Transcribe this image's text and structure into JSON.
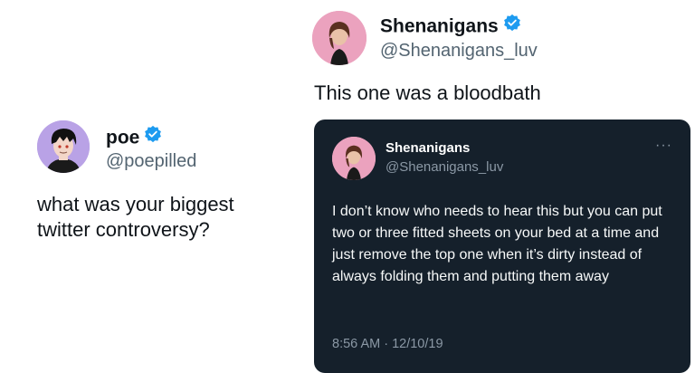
{
  "left_tweet": {
    "display_name": "poe",
    "handle": "@poepilled",
    "text": "what was your biggest twitter controversy?"
  },
  "right_tweet": {
    "display_name": "Shenanigans",
    "handle": "@Shenanigans_luv",
    "text": "This one was a bloodbath"
  },
  "quoted_tweet": {
    "display_name": "Shenanigans",
    "handle": "@Shenanigans_luv",
    "menu": "···",
    "text": "I don’t know who needs to hear this but you can put two or three fitted sheets on your bed at a time and just remove the top one when it’s dirty instead of always folding them and putting them away",
    "timestamp": "8:56 AM · 12/10/19"
  },
  "colors": {
    "verified_blue": "#1d9bf0",
    "card_background": "#15202b",
    "poe_avatar_bg": "#b9a2e6",
    "shenanigans_avatar_bg": "#eba2be"
  },
  "icons": {
    "verified": "verified-badge-icon",
    "more": "more-options-icon"
  }
}
